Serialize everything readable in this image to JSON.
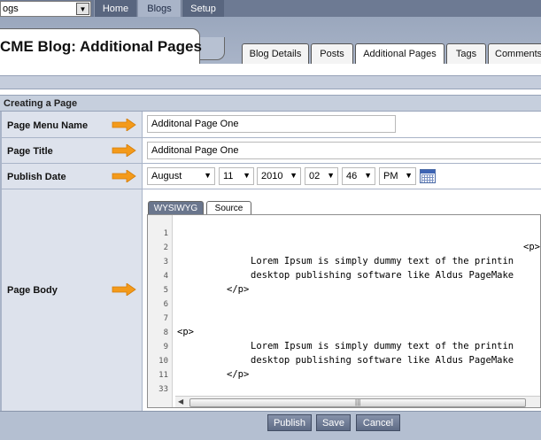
{
  "topnav": {
    "blog_select_value": "ogs",
    "items": [
      "Home",
      "Blogs",
      "Setup"
    ],
    "active": "Blogs"
  },
  "header": {
    "title": "CME Blog: Additional Pages",
    "tabs": [
      "Blog Details",
      "Posts",
      "Additional Pages",
      "Tags",
      "Comments"
    ],
    "active_tab": "Additional Pages"
  },
  "section": {
    "title": "Creating a Page"
  },
  "form": {
    "menu_name": {
      "label": "Page Menu Name",
      "value": "Additonal Page One"
    },
    "page_title": {
      "label": "Page Title",
      "value": "Additonal Page One"
    },
    "publish_date": {
      "label": "Publish Date",
      "month": "August",
      "day": "11",
      "year": "2010",
      "hour": "02",
      "minute": "46",
      "ampm": "PM"
    },
    "page_body": {
      "label": "Page Body",
      "tabs": [
        "WYSIWYG",
        "Source"
      ],
      "active_tab": "Source",
      "line_numbers": [
        "1",
        "2",
        "3",
        "4",
        "5",
        "6",
        "7",
        "8",
        "9",
        "10",
        "11",
        "33"
      ],
      "lines": [
        "",
        "<p>",
        "Lorem Ipsum is simply dummy text of the printin",
        "desktop publishing software like Aldus PageMake",
        "</p>",
        "",
        "",
        "<p>",
        "Lorem Ipsum is simply dummy text of the printin",
        "desktop publishing software like Aldus PageMake",
        "</p>"
      ]
    }
  },
  "buttons": {
    "publish": "Publish",
    "save": "Save",
    "cancel": "Cancel"
  },
  "colors": {
    "nav": "#6d7a93",
    "header": "#a9b4c8",
    "label_bg": "#dde2ec",
    "arrow": "#f39a1b"
  }
}
